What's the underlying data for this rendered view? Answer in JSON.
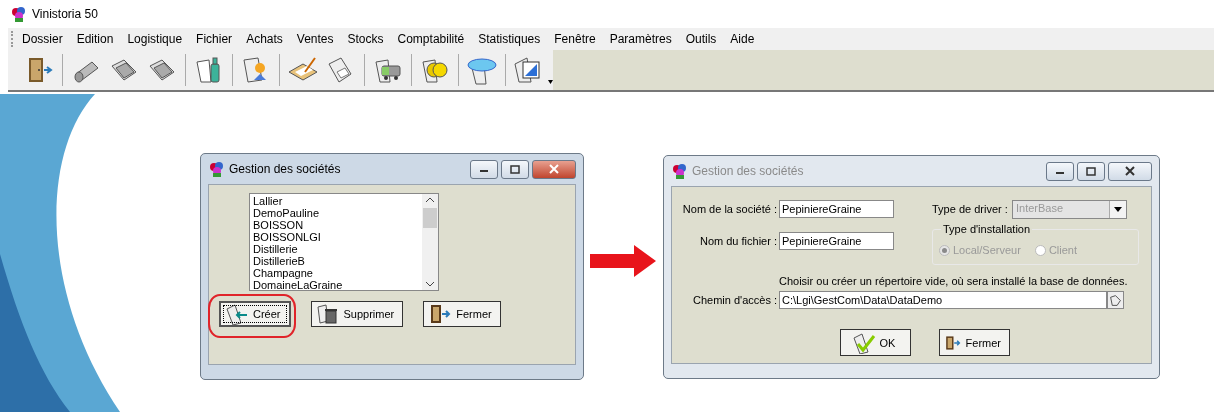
{
  "app": {
    "title": "Vinistoria 50"
  },
  "menu": [
    "Dossier",
    "Edition",
    "Logistique",
    "Fichier",
    "Achats",
    "Ventes",
    "Stocks",
    "Comptabilité",
    "Statistiques",
    "Fenêtre",
    "Paramètres",
    "Outils",
    "Aide"
  ],
  "dialog_list": {
    "title": "Gestion des sociétés",
    "active": true,
    "companies": [
      "Lallier",
      "DemoPauline",
      "BOISSON",
      "BOISSONLGI",
      "Distillerie",
      "DistillerieB",
      "Champagne",
      "DomaineLaGraine"
    ],
    "buttons": [
      {
        "kind": "create",
        "label": "Créer",
        "focused": true,
        "circled": true
      },
      {
        "kind": "delete",
        "label": "Supprimer",
        "focused": false,
        "circled": false
      },
      {
        "kind": "close",
        "label": "Fermer",
        "focused": false,
        "circled": false
      }
    ]
  },
  "dialog_form": {
    "title": "Gestion des sociétés",
    "active": false,
    "company_name": {
      "label": "Nom de la société :",
      "value": "PepiniereGraine"
    },
    "file_name": {
      "label": "Nom du fichier :",
      "value": "PepiniereGraine"
    },
    "driver": {
      "label": "Type de driver :",
      "value": "InterBase",
      "disabled": true
    },
    "installation": {
      "legend": "Type d'installation",
      "options": [
        {
          "label": "Local/Serveur",
          "selected": true,
          "disabled": true
        },
        {
          "label": "Client",
          "selected": false,
          "disabled": true
        }
      ]
    },
    "hint": "Choisir ou créer un répertoire vide, où sera installé la base de données.",
    "path": {
      "label": "Chemin d'accès :",
      "value": "C:\\Lgi\\GestCom\\Data\\DataDemo"
    },
    "buttons": [
      {
        "kind": "ok",
        "label": "OK",
        "focused": false,
        "circled": false
      },
      {
        "kind": "close",
        "label": "Fermer",
        "focused": false,
        "circled": false
      }
    ]
  }
}
